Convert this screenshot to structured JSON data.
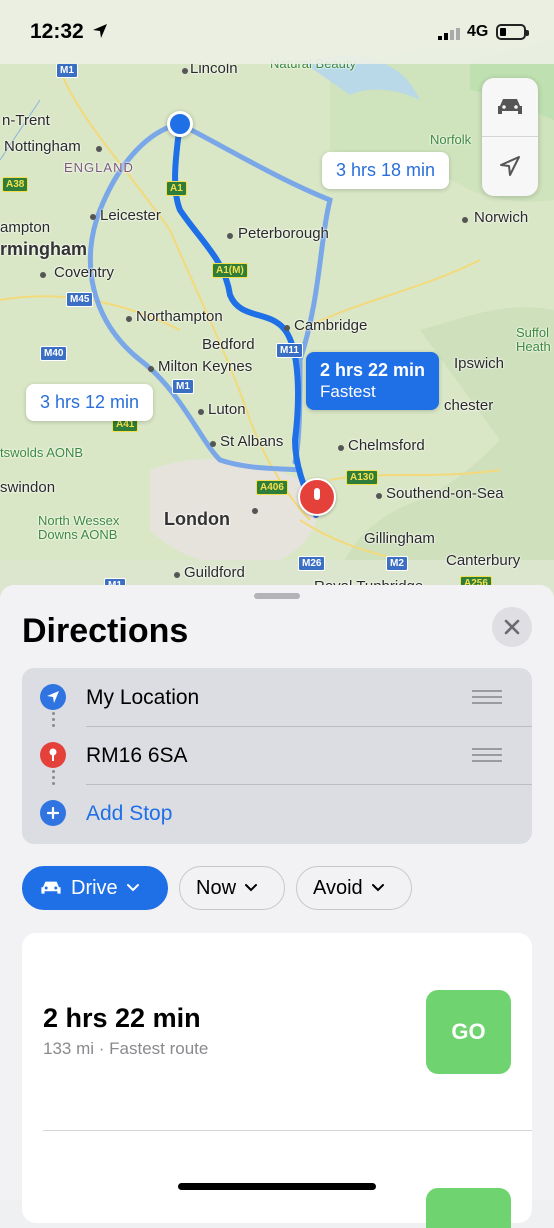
{
  "status_bar": {
    "time": "12:32",
    "network": "4G"
  },
  "map": {
    "places": [
      {
        "name": "Lincoln",
        "big": false
      },
      {
        "name": "n-Trent",
        "big": false
      },
      {
        "name": "Nottingham",
        "big": false
      },
      {
        "name": "Leicester",
        "big": false
      },
      {
        "name": "ampton",
        "big": false
      },
      {
        "name": "rmingham",
        "big": true
      },
      {
        "name": "Coventry",
        "big": false
      },
      {
        "name": "Peterborough",
        "big": false
      },
      {
        "name": "Northampton",
        "big": false
      },
      {
        "name": "Bedford",
        "big": false
      },
      {
        "name": "Milton Keynes",
        "big": false
      },
      {
        "name": "Cambridge",
        "big": false
      },
      {
        "name": "Norwich",
        "big": false
      },
      {
        "name": "Ipswich",
        "big": false
      },
      {
        "name": "chester",
        "big": false
      },
      {
        "name": "Luton",
        "big": false
      },
      {
        "name": "St Albans",
        "big": false
      },
      {
        "name": "Chelmsford",
        "big": false
      },
      {
        "name": "London",
        "big": true
      },
      {
        "name": "Southend-on-Sea",
        "big": false
      },
      {
        "name": "Gillingham",
        "big": false
      },
      {
        "name": "Canterbury",
        "big": false
      },
      {
        "name": "Guildford",
        "big": false
      },
      {
        "name": "swindon",
        "big": false
      },
      {
        "name": "Royal Tunbridge",
        "big": false
      }
    ],
    "region_label": "ENGLAND",
    "parks": [
      "Norfolk",
      "Suffol",
      "Heath",
      "North Wessex",
      "Downs AONB",
      "tswolds AONB",
      "Natural Beauty"
    ],
    "road_shields": [
      "M1",
      "A1",
      "A1(M)",
      "M11",
      "M45",
      "M40",
      "M1",
      "A41",
      "A38",
      "A406",
      "A130",
      "M26",
      "M2",
      "A256",
      "M1"
    ],
    "routes": [
      {
        "time": "3 hrs 18 min",
        "tag": "",
        "selected": false
      },
      {
        "time": "3 hrs 12 min",
        "tag": "",
        "selected": false
      },
      {
        "time": "2 hrs 22 min",
        "tag": "Fastest",
        "selected": true
      }
    ]
  },
  "sheet": {
    "title": "Directions",
    "waypoints": [
      {
        "label": "My Location",
        "icon": "location-arrow-icon",
        "color": "#2f74e0"
      },
      {
        "label": "RM16 6SA",
        "icon": "map-pin-icon",
        "color": "#e5413b"
      }
    ],
    "add_stop_label": "Add Stop",
    "transport_chips": [
      {
        "label": "Drive",
        "icon": "car-icon",
        "active": true
      },
      {
        "label": "Now",
        "icon": "",
        "active": false
      },
      {
        "label": "Avoid",
        "icon": "",
        "active": false
      }
    ],
    "route_card": {
      "time": "2 hrs 22 min",
      "subtitle": "133 mi · Fastest route",
      "go_label": "GO"
    }
  },
  "colors": {
    "accent": "#1f6fe6",
    "go_green": "#6fd36f",
    "pin_red": "#e5413b"
  }
}
